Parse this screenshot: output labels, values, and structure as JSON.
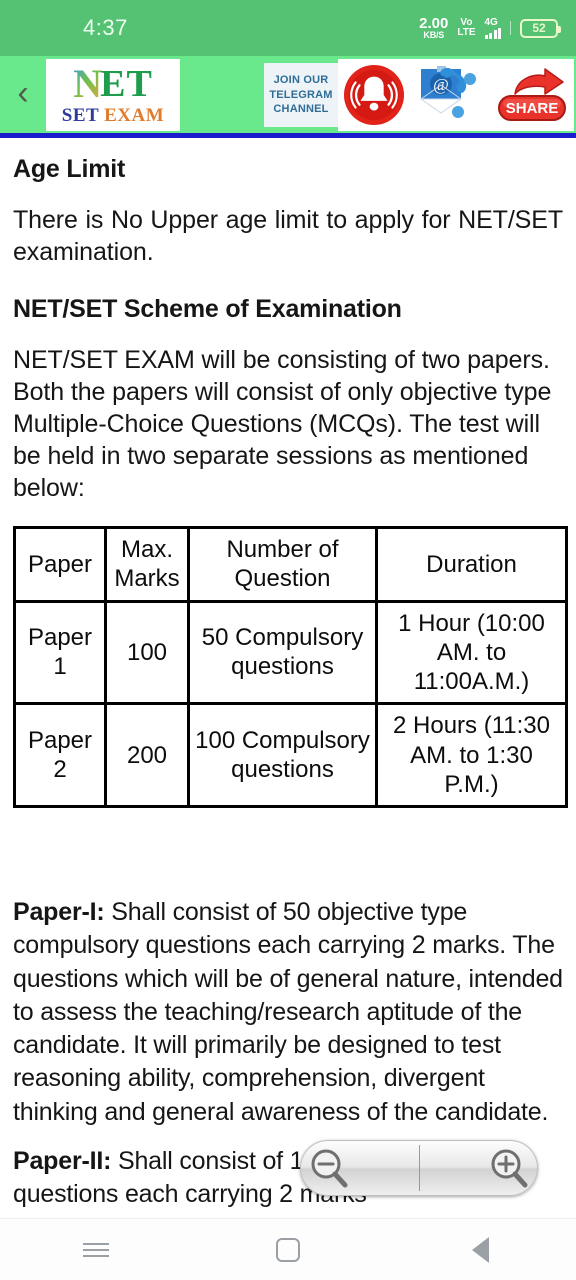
{
  "status_bar": {
    "time": "4:37",
    "network_speed_value": "2.00",
    "network_speed_unit": "KB/S",
    "volte_top": "Vo",
    "volte_bottom": "LTE",
    "network_type": "4G",
    "battery_level": "52"
  },
  "banner": {
    "back_icon": "chevron-left-icon",
    "logo_n": "N",
    "logo_et": "ET",
    "logo_set": "SET",
    "logo_exam": "EXAM",
    "telegram_line1": "Join Our",
    "telegram_line2": "Telegram",
    "telegram_line3": "Channel",
    "bell_icon": "notification-bell-icon",
    "mail_icon": "email-phone-contact-icon",
    "share_label": "SHARE",
    "accent_green_dark": "#55c172",
    "accent_green_light": "#6ae98c",
    "rule_blue": "#1b1ccb",
    "share_red": "#e02020"
  },
  "content": {
    "heading_age_limit": "Age Limit",
    "para_age_limit": "There is No Upper age limit to apply for NET/SET examination.",
    "heading_scheme": "NET/SET Scheme of Examination",
    "para_scheme": "NET/SET EXAM will be consisting of two papers. Both the papers will consist of only objective type Multiple-Choice Questions (MCQs). The test will be held in two separate sessions as mentioned below:",
    "table": {
      "headers": [
        "Paper",
        "Max. Marks",
        "Number of Question",
        "Duration"
      ],
      "rows": [
        [
          "Paper 1",
          "100",
          "50 Compulsory questions",
          "1 Hour (10:00 AM. to 11:00A.M.)"
        ],
        [
          "Paper 2",
          "200",
          "100 Compulsory questions",
          "2 Hours (11:30 AM. to 1:30 P.M.)"
        ]
      ]
    },
    "paper1_label": "Paper-I:",
    "paper1_text": " Shall consist of 50 objective type compulsory questions each carrying 2 marks. The questions which will be of general nature, intended to assess the teaching/research aptitude of the candidate. It will primarily be designed to test reasoning ability, comprehension, divergent thinking and general awareness of the candidate.",
    "paper2_label": "Paper-II:",
    "paper2_text": " Shall consist of 100 compulsory questions each carrying 2 marks"
  },
  "zoom_control": {
    "zoom_out_icon": "zoom-out-magnifier-icon",
    "zoom_in_icon": "zoom-in-magnifier-icon"
  },
  "navigation_bar": {
    "recents_icon": "recents-menu-icon",
    "home_icon": "home-square-icon",
    "back_icon": "back-triangle-icon"
  }
}
